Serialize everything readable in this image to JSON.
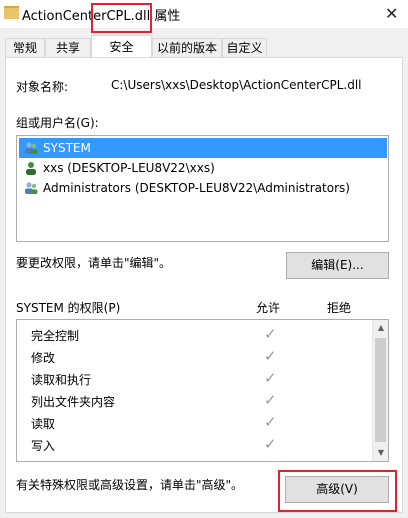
{
  "window": {
    "title": "ActionCenterCPL.dll 属性",
    "close_glyph": "✕"
  },
  "tabs": [
    "常规",
    "共享",
    "安全",
    "以前的版本",
    "自定义"
  ],
  "active_tab": "安全",
  "object": {
    "label": "对象名称:",
    "value": "C:\\Users\\xxs\\Desktop\\ActionCenterCPL.dll"
  },
  "group": {
    "label": "组或用户名(G):",
    "users": [
      {
        "name": "SYSTEM",
        "selected": true
      },
      {
        "name": "xxs (DESKTOP-LEU8V22\\xxs)",
        "selected": false
      },
      {
        "name": "Administrators (DESKTOP-LEU8V22\\Administrators)",
        "selected": false
      }
    ]
  },
  "edit": {
    "hint": "要更改权限，请单击\"编辑\"。",
    "button_label": "编辑(E)..."
  },
  "permissions": {
    "title": "SYSTEM 的权限(P)",
    "allow_header": "允许",
    "deny_header": "拒绝",
    "rows": [
      {
        "name": "完全控制",
        "allow": true,
        "deny": false
      },
      {
        "name": "修改",
        "allow": true,
        "deny": false
      },
      {
        "name": "读取和执行",
        "allow": true,
        "deny": false
      },
      {
        "name": "列出文件夹内容",
        "allow": true,
        "deny": false
      },
      {
        "name": "读取",
        "allow": true,
        "deny": false
      },
      {
        "name": "写入",
        "allow": true,
        "deny": false
      }
    ],
    "check_glyph": "✓"
  },
  "advanced": {
    "hint": "有关特殊权限或高级设置，请单击\"高级\"。",
    "button_label": "高级(V)"
  },
  "colors": {
    "highlight": "#e0242d",
    "selection": "#3399ff",
    "check": "#9a9a9a"
  }
}
